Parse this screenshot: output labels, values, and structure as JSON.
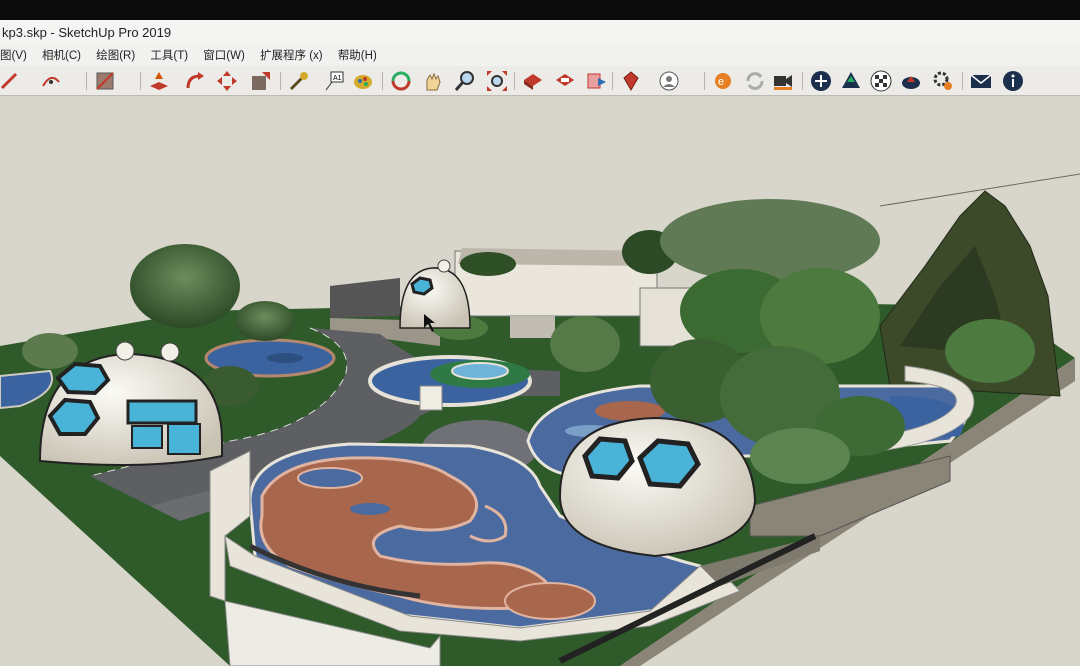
{
  "window": {
    "title": "kp3.skp - SketchUp Pro 2019"
  },
  "menu": [
    {
      "label": "图(V)"
    },
    {
      "label": "相机(C)"
    },
    {
      "label": "绘图(R)"
    },
    {
      "label": "工具(T)"
    },
    {
      "label": "窗口(W)"
    },
    {
      "label": "扩展程序 (x)"
    },
    {
      "label": "帮助(H)"
    }
  ],
  "toolbar": {
    "tools": [
      "pencil-icon",
      "arc-icon",
      "shape-icon",
      "push-pull-icon",
      "follow-me-icon",
      "move-icon",
      "offset-icon",
      "tape-measure-icon",
      "text-icon",
      "paint-bucket-icon",
      "orbit-icon",
      "pan-icon",
      "zoom-icon",
      "zoom-extents-icon",
      "warehouse-icon",
      "extension-warehouse-icon",
      "send-to-layout-icon",
      "ruby-icon",
      "user-icon",
      "sync-icon",
      "video-icon",
      "add-icon",
      "upload-icon",
      "checker-icon",
      "cloud-icon",
      "settings-icon",
      "mail-icon",
      "info-icon"
    ]
  },
  "colors": {
    "pond_blue": "#4a6aa0",
    "terracotta": "#a8674c",
    "grass": "#2f5a2a",
    "dome": "#f0ece2"
  }
}
